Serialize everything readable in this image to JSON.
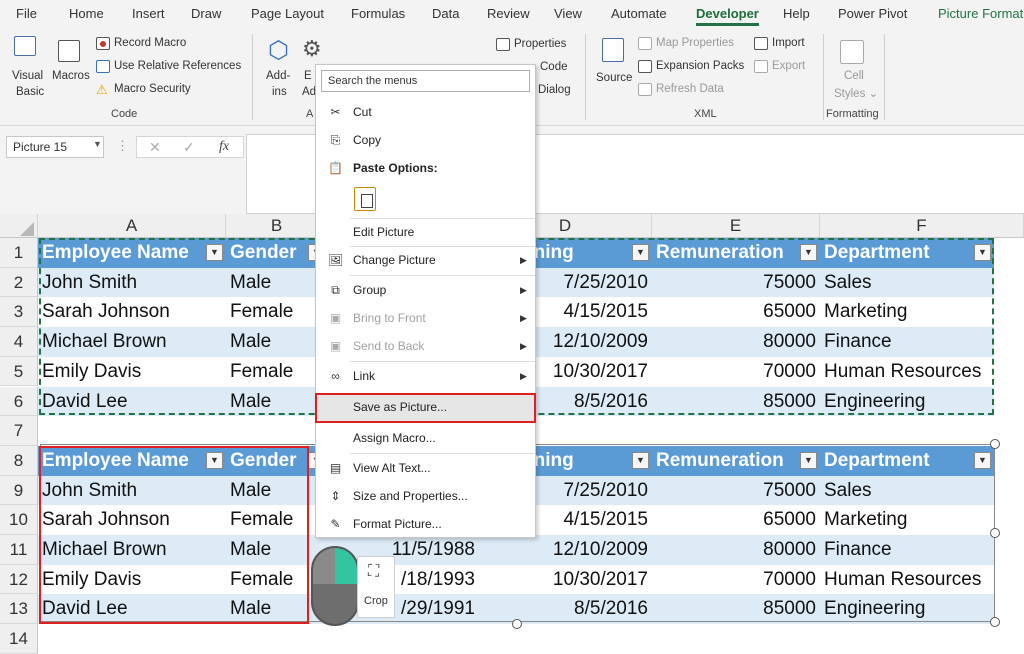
{
  "menubar": {
    "tabs": [
      "File",
      "Home",
      "Insert",
      "Draw",
      "Page Layout",
      "Formulas",
      "Data",
      "Review",
      "View",
      "Automate",
      "Developer",
      "Help",
      "Power Pivot",
      "Picture Format"
    ]
  },
  "ribbon": {
    "code": {
      "visual_basic_1": "Visual",
      "visual_basic_2": "Basic",
      "macros": "Macros",
      "record": "Record Macro",
      "relative": "Use Relative References",
      "security": "Macro Security",
      "label": "Code"
    },
    "addins": {
      "addins_1": "Add-",
      "addins_2": "ins",
      "excel_1": "E",
      "excel_2": "Ad",
      "label": "A"
    },
    "controls": {
      "properties": "Properties",
      "view_code": "View Code",
      "dialog": "Dialog",
      "view_code_visible": "Code"
    },
    "xml": {
      "source": "Source",
      "map_properties": "Map Properties",
      "expansion_packs": "Expansion Packs",
      "refresh_data": "Refresh Data",
      "import": "Import",
      "export": "Export",
      "label": "XML"
    },
    "formatting": {
      "cell_styles_1": "Cell",
      "cell_styles_2": "Styles",
      "label": "Formatting"
    }
  },
  "formula_bar": {
    "name_box": "Picture 15",
    "fx": "fx"
  },
  "columns": [
    "A",
    "B",
    "C",
    "D",
    "E",
    "F"
  ],
  "rows": [
    "1",
    "2",
    "3",
    "4",
    "5",
    "6",
    "7",
    "8",
    "9",
    "10",
    "11",
    "12",
    "13",
    "14"
  ],
  "table1": {
    "headers": [
      "Employee Name",
      "Gender",
      "Date of Joining",
      "Remuneration",
      "Department"
    ],
    "visible_headers": [
      "Employee Name",
      "Gender",
      "of Joining",
      "Remuneration",
      "Department"
    ],
    "rows": [
      {
        "name": "John Smith",
        "gender": "Male",
        "joining": "7/25/2010",
        "pay": "75000",
        "dept": "Sales"
      },
      {
        "name": "Sarah Johnson",
        "gender": "Female",
        "joining": "4/15/2015",
        "pay": "65000",
        "dept": "Marketing"
      },
      {
        "name": "Michael Brown",
        "gender": "Male",
        "joining": "12/10/2009",
        "pay": "80000",
        "dept": "Finance"
      },
      {
        "name": "Emily Davis",
        "gender": "Female",
        "joining": "10/30/2017",
        "pay": "70000",
        "dept": "Human Resources"
      },
      {
        "name": "David Lee",
        "gender": "Male",
        "joining": "8/5/2016",
        "pay": "85000",
        "dept": "Engineering"
      }
    ]
  },
  "table2": {
    "visible_headers": [
      "Employee Name",
      "Gender",
      "of Joining",
      "Remuneration",
      "Department"
    ],
    "rows": [
      {
        "name": "John Smith",
        "gender": "Male",
        "dob": "",
        "joining": "7/25/2010",
        "pay": "75000",
        "dept": "Sales"
      },
      {
        "name": "Sarah Johnson",
        "gender": "Female",
        "dob": "",
        "joining": "4/15/2015",
        "pay": "65000",
        "dept": "Marketing"
      },
      {
        "name": "Michael Brown",
        "gender": "Male",
        "dob": "11/5/1988",
        "joining": "12/10/2009",
        "pay": "80000",
        "dept": "Finance"
      },
      {
        "name": "Emily Davis",
        "gender": "Female",
        "dob": "/18/1993",
        "joining": "10/30/2017",
        "pay": "70000",
        "dept": "Human Resources"
      },
      {
        "name": "David Lee",
        "gender": "Male",
        "dob": "/29/1991",
        "joining": "8/5/2016",
        "pay": "85000",
        "dept": "Engineering"
      }
    ]
  },
  "context_menu": {
    "search_placeholder": "Search the menus",
    "items": {
      "cut": "Cut",
      "copy": "Copy",
      "paste_options": "Paste Options:",
      "edit_picture": "Edit Picture",
      "change_picture": "Change Picture",
      "group": "Group",
      "bring_to_front": "Bring to Front",
      "send_to_back": "Send to Back",
      "link": "Link",
      "save_as_picture": "Save as Picture...",
      "assign_macro": "Assign Macro...",
      "view_alt_text": "View Alt Text...",
      "size_properties": "Size and Properties...",
      "format_picture": "Format Picture..."
    }
  },
  "mini_toolbar": {
    "crop": "Crop"
  },
  "colors": {
    "header_blue": "#5b9bd5",
    "band_blue": "#ddebf7",
    "highlight_red": "#e0201e",
    "developer_green": "#217346",
    "mouse_green": "#35c4a0"
  }
}
